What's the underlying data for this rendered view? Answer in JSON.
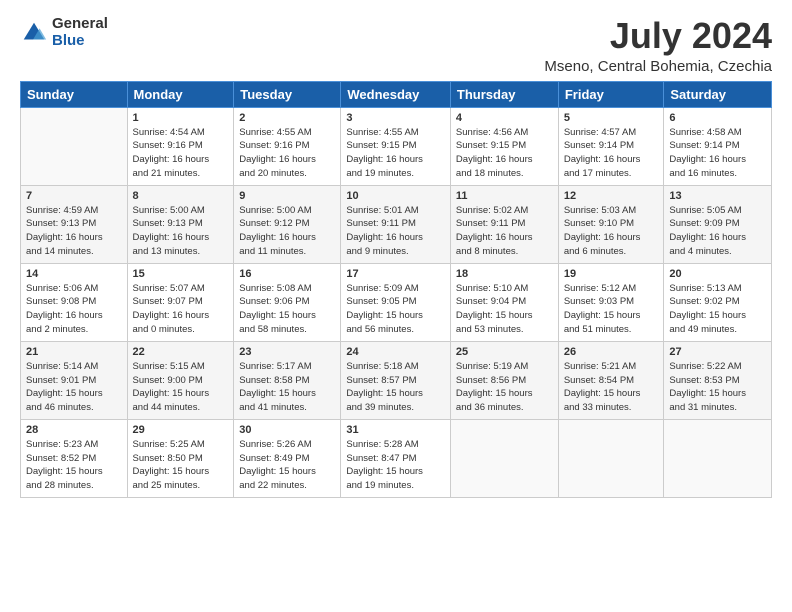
{
  "logo": {
    "general": "General",
    "blue": "Blue"
  },
  "title": "July 2024",
  "location": "Mseno, Central Bohemia, Czechia",
  "days_of_week": [
    "Sunday",
    "Monday",
    "Tuesday",
    "Wednesday",
    "Thursday",
    "Friday",
    "Saturday"
  ],
  "weeks": [
    [
      {
        "day": "",
        "info": ""
      },
      {
        "day": "1",
        "info": "Sunrise: 4:54 AM\nSunset: 9:16 PM\nDaylight: 16 hours\nand 21 minutes."
      },
      {
        "day": "2",
        "info": "Sunrise: 4:55 AM\nSunset: 9:16 PM\nDaylight: 16 hours\nand 20 minutes."
      },
      {
        "day": "3",
        "info": "Sunrise: 4:55 AM\nSunset: 9:15 PM\nDaylight: 16 hours\nand 19 minutes."
      },
      {
        "day": "4",
        "info": "Sunrise: 4:56 AM\nSunset: 9:15 PM\nDaylight: 16 hours\nand 18 minutes."
      },
      {
        "day": "5",
        "info": "Sunrise: 4:57 AM\nSunset: 9:14 PM\nDaylight: 16 hours\nand 17 minutes."
      },
      {
        "day": "6",
        "info": "Sunrise: 4:58 AM\nSunset: 9:14 PM\nDaylight: 16 hours\nand 16 minutes."
      }
    ],
    [
      {
        "day": "7",
        "info": "Sunrise: 4:59 AM\nSunset: 9:13 PM\nDaylight: 16 hours\nand 14 minutes."
      },
      {
        "day": "8",
        "info": "Sunrise: 5:00 AM\nSunset: 9:13 PM\nDaylight: 16 hours\nand 13 minutes."
      },
      {
        "day": "9",
        "info": "Sunrise: 5:00 AM\nSunset: 9:12 PM\nDaylight: 16 hours\nand 11 minutes."
      },
      {
        "day": "10",
        "info": "Sunrise: 5:01 AM\nSunset: 9:11 PM\nDaylight: 16 hours\nand 9 minutes."
      },
      {
        "day": "11",
        "info": "Sunrise: 5:02 AM\nSunset: 9:11 PM\nDaylight: 16 hours\nand 8 minutes."
      },
      {
        "day": "12",
        "info": "Sunrise: 5:03 AM\nSunset: 9:10 PM\nDaylight: 16 hours\nand 6 minutes."
      },
      {
        "day": "13",
        "info": "Sunrise: 5:05 AM\nSunset: 9:09 PM\nDaylight: 16 hours\nand 4 minutes."
      }
    ],
    [
      {
        "day": "14",
        "info": "Sunrise: 5:06 AM\nSunset: 9:08 PM\nDaylight: 16 hours\nand 2 minutes."
      },
      {
        "day": "15",
        "info": "Sunrise: 5:07 AM\nSunset: 9:07 PM\nDaylight: 16 hours\nand 0 minutes."
      },
      {
        "day": "16",
        "info": "Sunrise: 5:08 AM\nSunset: 9:06 PM\nDaylight: 15 hours\nand 58 minutes."
      },
      {
        "day": "17",
        "info": "Sunrise: 5:09 AM\nSunset: 9:05 PM\nDaylight: 15 hours\nand 56 minutes."
      },
      {
        "day": "18",
        "info": "Sunrise: 5:10 AM\nSunset: 9:04 PM\nDaylight: 15 hours\nand 53 minutes."
      },
      {
        "day": "19",
        "info": "Sunrise: 5:12 AM\nSunset: 9:03 PM\nDaylight: 15 hours\nand 51 minutes."
      },
      {
        "day": "20",
        "info": "Sunrise: 5:13 AM\nSunset: 9:02 PM\nDaylight: 15 hours\nand 49 minutes."
      }
    ],
    [
      {
        "day": "21",
        "info": "Sunrise: 5:14 AM\nSunset: 9:01 PM\nDaylight: 15 hours\nand 46 minutes."
      },
      {
        "day": "22",
        "info": "Sunrise: 5:15 AM\nSunset: 9:00 PM\nDaylight: 15 hours\nand 44 minutes."
      },
      {
        "day": "23",
        "info": "Sunrise: 5:17 AM\nSunset: 8:58 PM\nDaylight: 15 hours\nand 41 minutes."
      },
      {
        "day": "24",
        "info": "Sunrise: 5:18 AM\nSunset: 8:57 PM\nDaylight: 15 hours\nand 39 minutes."
      },
      {
        "day": "25",
        "info": "Sunrise: 5:19 AM\nSunset: 8:56 PM\nDaylight: 15 hours\nand 36 minutes."
      },
      {
        "day": "26",
        "info": "Sunrise: 5:21 AM\nSunset: 8:54 PM\nDaylight: 15 hours\nand 33 minutes."
      },
      {
        "day": "27",
        "info": "Sunrise: 5:22 AM\nSunset: 8:53 PM\nDaylight: 15 hours\nand 31 minutes."
      }
    ],
    [
      {
        "day": "28",
        "info": "Sunrise: 5:23 AM\nSunset: 8:52 PM\nDaylight: 15 hours\nand 28 minutes."
      },
      {
        "day": "29",
        "info": "Sunrise: 5:25 AM\nSunset: 8:50 PM\nDaylight: 15 hours\nand 25 minutes."
      },
      {
        "day": "30",
        "info": "Sunrise: 5:26 AM\nSunset: 8:49 PM\nDaylight: 15 hours\nand 22 minutes."
      },
      {
        "day": "31",
        "info": "Sunrise: 5:28 AM\nSunset: 8:47 PM\nDaylight: 15 hours\nand 19 minutes."
      },
      {
        "day": "",
        "info": ""
      },
      {
        "day": "",
        "info": ""
      },
      {
        "day": "",
        "info": ""
      }
    ]
  ]
}
